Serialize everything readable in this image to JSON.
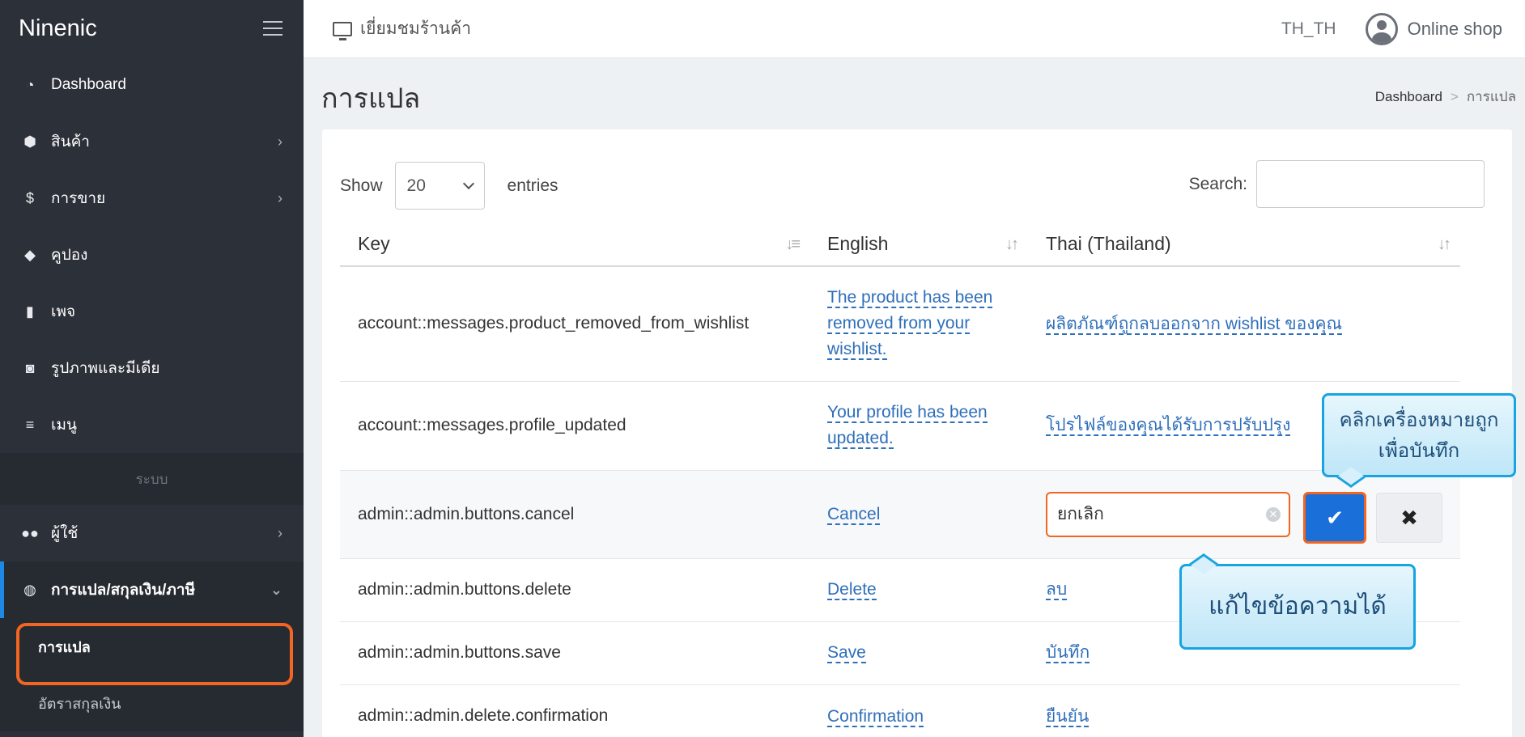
{
  "sidebar": {
    "brand": "Ninenic",
    "items": [
      {
        "icon": "dashboard-icon",
        "label": "Dashboard"
      },
      {
        "icon": "box-icon",
        "label": "สินค้า"
      },
      {
        "icon": "dollar-icon",
        "label": "การขาย"
      },
      {
        "icon": "tags-icon",
        "label": "คูปอง"
      },
      {
        "icon": "file-icon",
        "label": "เพจ"
      },
      {
        "icon": "camera-icon",
        "label": "รูปภาพและมีเดีย"
      },
      {
        "icon": "list-icon",
        "label": "เมนู"
      }
    ],
    "section_label": "ระบบ",
    "users_label": "ผู้ใช้",
    "active_label": "การแปล/สกุลเงิน/ภาษี",
    "sub_items": [
      "การแปล",
      "อัตราสกุลเงิน"
    ]
  },
  "topbar": {
    "store_label": "เยี่ยมชมร้านค้า",
    "locale": "TH_TH",
    "user_label": "Online shop"
  },
  "page": {
    "title": "การแปล",
    "breadcrumb_home": "Dashboard",
    "breadcrumb_sep": ">",
    "breadcrumb_current": "การแปล"
  },
  "table": {
    "show_label": "Show",
    "page_size": "20",
    "entries_label": "entries",
    "search_label": "Search:",
    "columns": [
      "Key",
      "English",
      "Thai (Thailand)"
    ],
    "rows": [
      {
        "key": "account::messages.product_removed_from_wishlist",
        "en": "The product has been removed from your wishlist.",
        "th": "ผลิตภัณฑ์ถูกลบออกจาก wishlist ของคุณ"
      },
      {
        "key": "account::messages.profile_updated",
        "en": "Your profile has been updated.",
        "th": "โปรไฟล์ของคุณได้รับการปรับปรุง"
      },
      {
        "key": "admin::admin.buttons.cancel",
        "en": "Cancel",
        "th": "ยกเลิก"
      },
      {
        "key": "admin::admin.buttons.delete",
        "en": "Delete",
        "th": "ลบ"
      },
      {
        "key": "admin::admin.buttons.save",
        "en": "Save",
        "th": "บันทึก"
      },
      {
        "key": "admin::admin.delete.confirmation",
        "en": "Confirmation",
        "th": "ยืนยัน"
      }
    ]
  },
  "callouts": {
    "save_hint": "คลิกเครื่องหมายถูก เพื่อบันทึก",
    "edit_hint": "แก้ไขข้อความได้"
  },
  "colors": {
    "sidebar_bg": "#2c3038",
    "highlight": "#f26522",
    "link": "#2f6fba",
    "primary": "#1a6fd8",
    "callout_border": "#18a4e0"
  }
}
